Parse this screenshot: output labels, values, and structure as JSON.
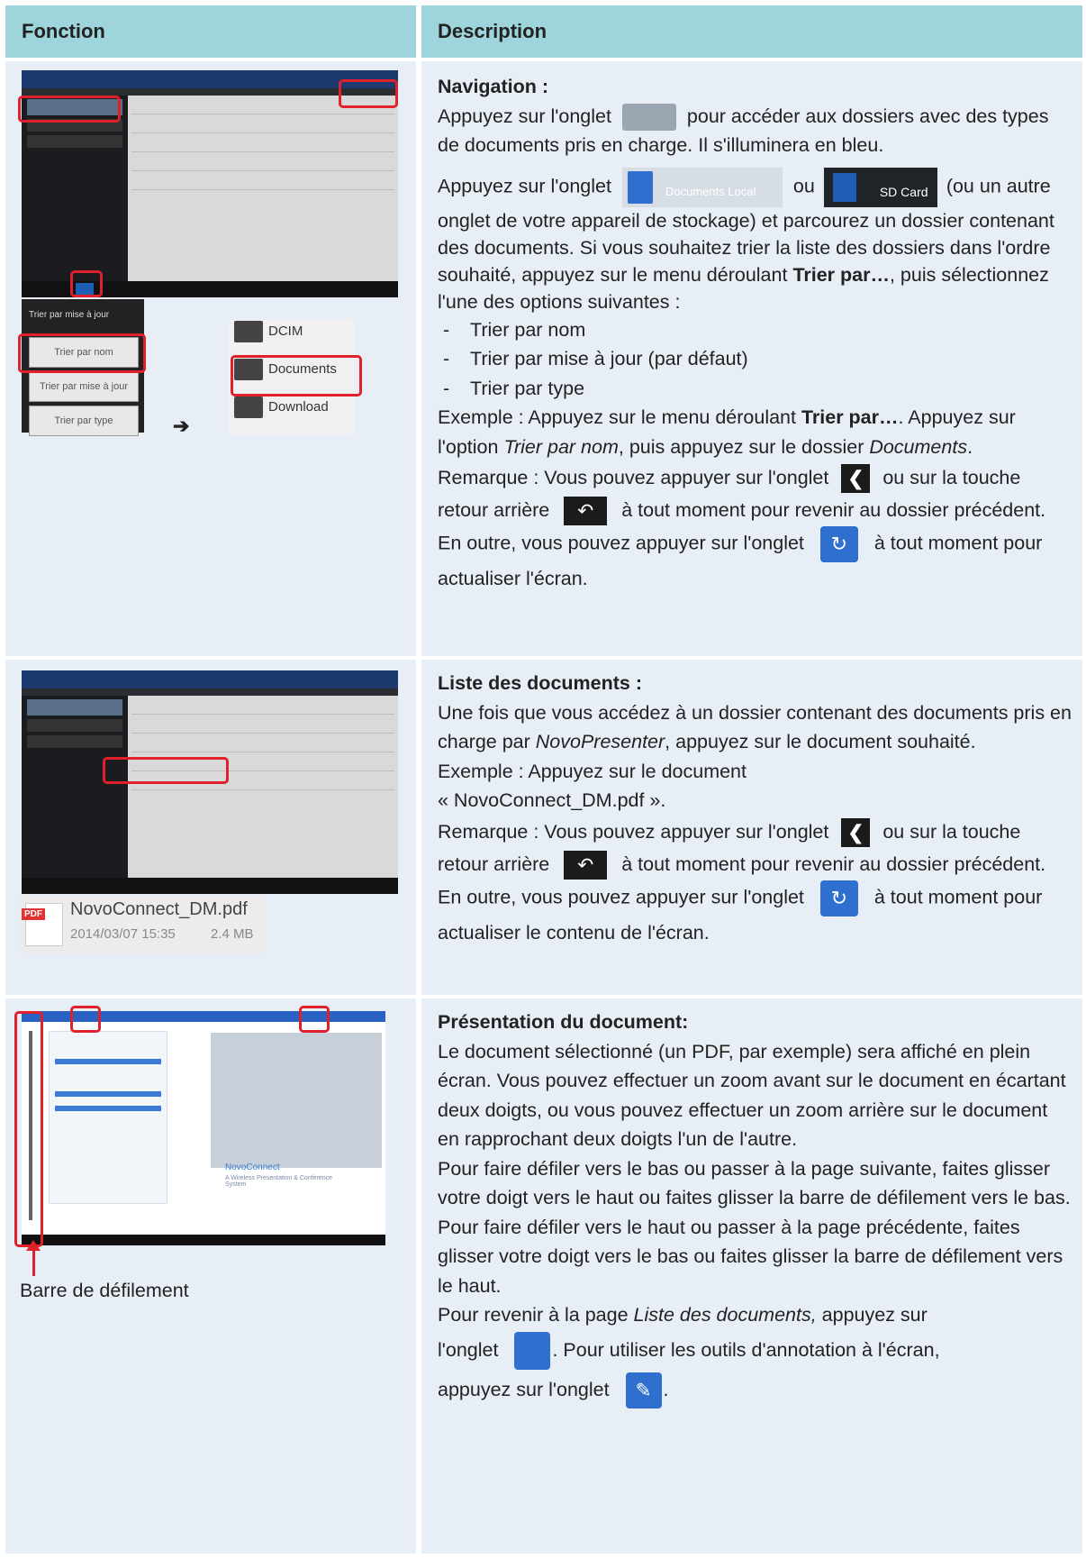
{
  "header": {
    "col1": "Fonction",
    "col2": "Description"
  },
  "row1": {
    "title": "Navigation :",
    "p1_a": "Appuyez sur l'onglet",
    "p1_b": "pour accéder aux dossiers avec des types de documents pris en charge. Il s'illuminera en bleu.",
    "p2_a": "Appuyez sur l'onglet",
    "documents_local_label": "Documents Local",
    "p2_ou": "ou",
    "sd_card_label": "SD Card",
    "p2_b": "(ou un autre onglet de votre appareil de stockage) et parcourez un dossier contenant des documents. Si vous souhaitez trier la liste des dossiers dans l'ordre souhaité, appuyez sur le menu déroulant ",
    "p2_bold": "Trier par…",
    "p2_c": ", puis sélectionnez l'une des options suivantes :",
    "options": [
      "Trier par nom",
      "Trier par mise à jour (par défaut)",
      "Trier par type"
    ],
    "ex_a": "Exemple : Appuyez sur le menu déroulant ",
    "ex_bold": "Trier par…",
    "ex_b": ".",
    "ex_c": "Appuyez sur l'option ",
    "ex_italic1": "Trier par nom",
    "ex_d": ", puis appuyez sur le dossier ",
    "ex_italic2": "Documents",
    "ex_e": ".",
    "rem_a": "Remarque : Vous pouvez appuyer sur l'onglet",
    "rem_b": "ou sur la",
    "rem_c": "touche retour arrière",
    "rem_d": "à tout moment pour revenir au dossier précédent. En outre, vous pouvez appuyer sur",
    "rem_e": "l'onglet",
    "rem_f": "à tout moment pour actualiser l'écran.",
    "sort_header": "Trier par mise à jour",
    "sort_opts": [
      "Trier par nom",
      "Trier par mise à jour",
      "Trier par type"
    ],
    "folders": [
      "DCIM",
      "Documents",
      "Download"
    ],
    "arrow": "➔"
  },
  "row2": {
    "title": "Liste des documents :",
    "p1_a": "Une fois que vous accédez à un dossier contenant des documents pris en charge par ",
    "p1_italic": "NovoPresenter",
    "p1_b": ", appuyez sur le document souhaité.",
    "ex_a": "Exemple : Appuyez sur le document",
    "ex_b": "« NovoConnect_DM.pdf ».",
    "rem_a": "Remarque : Vous pouvez appuyer sur l'onglet",
    "rem_b": "ou sur la",
    "rem_c": "touche retour arrière",
    "rem_d": "à tout moment pour revenir au dossier précédent. En outre, vous pouvez appuyer sur",
    "rem_e": "l'onglet",
    "rem_f": "à tout moment pour actualiser le contenu de l'écran.",
    "pdf_name": "NovoConnect_DM.pdf",
    "pdf_date": "2014/03/07 15:35",
    "pdf_size": "2.4 MB",
    "pdf_badge": "PDF"
  },
  "row3": {
    "title": "Présentation du document:",
    "p1": "Le document sélectionné (un PDF, par exemple) sera affiché en plein écran. Vous pouvez effectuer un zoom avant sur le document en écartant deux doigts, ou vous pouvez effectuer un zoom arrière sur le document en rapprochant deux doigts l'un de l'autre.",
    "p2": "Pour faire défiler vers le bas ou passer à la page suivante, faites glisser votre doigt vers le haut ou faites glisser la barre de défilement vers le bas. Pour faire défiler vers le haut ou passer à la page précédente, faites glisser votre doigt vers le bas ou faites glisser la barre de défilement vers le haut.",
    "p3_a": "Pour revenir à la page ",
    "p3_italic": "Liste des documents,",
    "p3_b": " appuyez sur",
    "p4_a": "l'onglet",
    "p4_b": ". Pour utiliser les outils d'annotation à l'écran,",
    "p5_a": "appuyez sur l'onglet",
    "p5_b": ".",
    "scrollbar_caption": "Barre de défilement",
    "slide_brand": "NovoConnect",
    "slide_sub": "A Wireless Presentation & Conference System"
  },
  "colors": {
    "header_bg": "#9ed5dd",
    "cell_bg": "#e7eef6",
    "highlight": "#e0202a",
    "blue_icon": "#2f6fd0"
  }
}
